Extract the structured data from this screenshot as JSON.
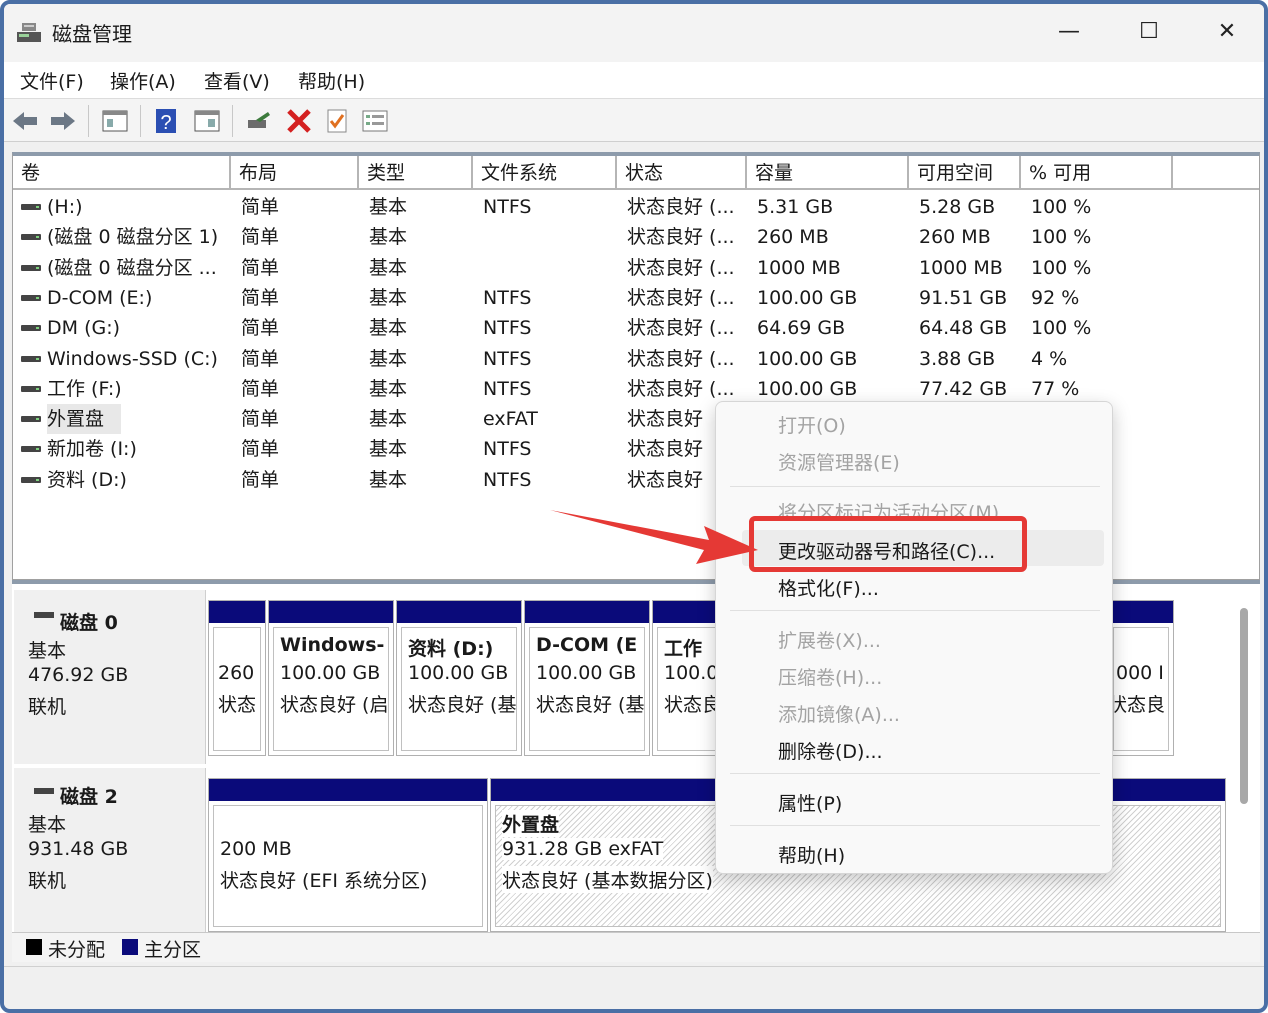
{
  "window": {
    "title": "磁盘管理",
    "controls": {
      "minimize": "—",
      "maximize": "☐",
      "close": "✕"
    }
  },
  "menu": [
    "文件(F)",
    "操作(A)",
    "查看(V)",
    "帮助(H)"
  ],
  "toolbar": {
    "icons": [
      "back-arrow-icon",
      "forward-arrow-icon",
      "view-icon",
      "help-icon",
      "properties-icon",
      "connect-icon",
      "delete-icon",
      "checkbox-icon",
      "list-icon"
    ]
  },
  "volume_list": {
    "columns": [
      "卷",
      "布局",
      "类型",
      "文件系统",
      "状态",
      "容量",
      "可用空间",
      "% 可用"
    ],
    "rows": [
      {
        "volume": "(H:)",
        "layout": "简单",
        "type": "基本",
        "fs": "NTFS",
        "status": "状态良好 (...",
        "capacity": "5.31 GB",
        "free": "5.28 GB",
        "pct": "100 %"
      },
      {
        "volume": "(磁盘 0 磁盘分区 1)",
        "layout": "简单",
        "type": "基本",
        "fs": "",
        "status": "状态良好 (...",
        "capacity": "260 MB",
        "free": "260 MB",
        "pct": "100 %"
      },
      {
        "volume": "(磁盘 0 磁盘分区 ...",
        "layout": "简单",
        "type": "基本",
        "fs": "",
        "status": "状态良好 (...",
        "capacity": "1000 MB",
        "free": "1000 MB",
        "pct": "100 %"
      },
      {
        "volume": "D-COM (E:)",
        "layout": "简单",
        "type": "基本",
        "fs": "NTFS",
        "status": "状态良好 (...",
        "capacity": "100.00 GB",
        "free": "91.51 GB",
        "pct": "92 %"
      },
      {
        "volume": "DM (G:)",
        "layout": "简单",
        "type": "基本",
        "fs": "NTFS",
        "status": "状态良好 (...",
        "capacity": "64.69 GB",
        "free": "64.48 GB",
        "pct": "100 %"
      },
      {
        "volume": "Windows-SSD (C:)",
        "layout": "简单",
        "type": "基本",
        "fs": "NTFS",
        "status": "状态良好 (...",
        "capacity": "100.00 GB",
        "free": "3.88 GB",
        "pct": "4 %"
      },
      {
        "volume": "工作 (F:)",
        "layout": "简单",
        "type": "基本",
        "fs": "NTFS",
        "status": "状态良好 (...",
        "capacity": "100.00 GB",
        "free": "77.42 GB",
        "pct": "77 %"
      },
      {
        "volume": "外置盘",
        "layout": "简单",
        "type": "基本",
        "fs": "exFAT",
        "status": "状态良好",
        "capacity": "",
        "free": "",
        "pct": ""
      },
      {
        "volume": "新加卷 (I:)",
        "layout": "简单",
        "type": "基本",
        "fs": "NTFS",
        "status": "状态良好",
        "capacity": "",
        "free": "",
        "pct": ""
      },
      {
        "volume": "资料 (D:)",
        "layout": "简单",
        "type": "基本",
        "fs": "NTFS",
        "status": "状态良好",
        "capacity": "",
        "free": "",
        "pct": ""
      }
    ]
  },
  "disks": [
    {
      "name": "磁盘 0",
      "kind": "基本",
      "size": "476.92 GB",
      "state": "联机",
      "partitions": [
        {
          "l1": "260",
          "l2": "状态",
          "l3": ""
        },
        {
          "l1": "Windows-",
          "l2": "100.00 GB",
          "l3": "状态良好 (启"
        },
        {
          "l1": "资料 (D:)",
          "l2": "100.00 GB",
          "l3": "状态良好 (基"
        },
        {
          "l1": "D-COM (E",
          "l2": "100.00 GB",
          "l3": "状态良好 (基"
        },
        {
          "l1": "工作",
          "l2": "100.0",
          "l3": "状态良"
        },
        {
          "l1": "",
          "l2": "000 I",
          "l3": "状态良"
        }
      ]
    },
    {
      "name": "磁盘 2",
      "kind": "基本",
      "size": "931.48 GB",
      "state": "联机",
      "partitions": [
        {
          "l1": "",
          "l2": "200 MB",
          "l3": "状态良好 (EFI 系统分区)"
        },
        {
          "l1": "外置盘",
          "l2": "931.28 GB exFAT",
          "l3": "状态良好 (基本数据分区)"
        }
      ]
    }
  ],
  "legend": {
    "unallocated": "未分配",
    "primary": "主分区",
    "unallocated_color": "#000000",
    "primary_color": "#0a0a7a"
  },
  "context_menu": {
    "items": [
      {
        "label": "打开(O)",
        "enabled": false
      },
      {
        "label": "资源管理器(E)",
        "enabled": false
      },
      {
        "label": "将分区标记为活动分区(M)",
        "enabled": false
      },
      {
        "label": "更改驱动器号和路径(C)...",
        "enabled": true,
        "highlighted": true
      },
      {
        "label": "格式化(F)...",
        "enabled": true
      },
      {
        "label": "扩展卷(X)...",
        "enabled": false
      },
      {
        "label": "压缩卷(H)...",
        "enabled": false
      },
      {
        "label": "添加镜像(A)...",
        "enabled": false
      },
      {
        "label": "删除卷(D)...",
        "enabled": true
      },
      {
        "label": "属性(P)",
        "enabled": true
      },
      {
        "label": "帮助(H)",
        "enabled": true
      }
    ]
  },
  "colors": {
    "accent_annotation": "#e53935",
    "primary_partition": "#0a0a7a"
  }
}
